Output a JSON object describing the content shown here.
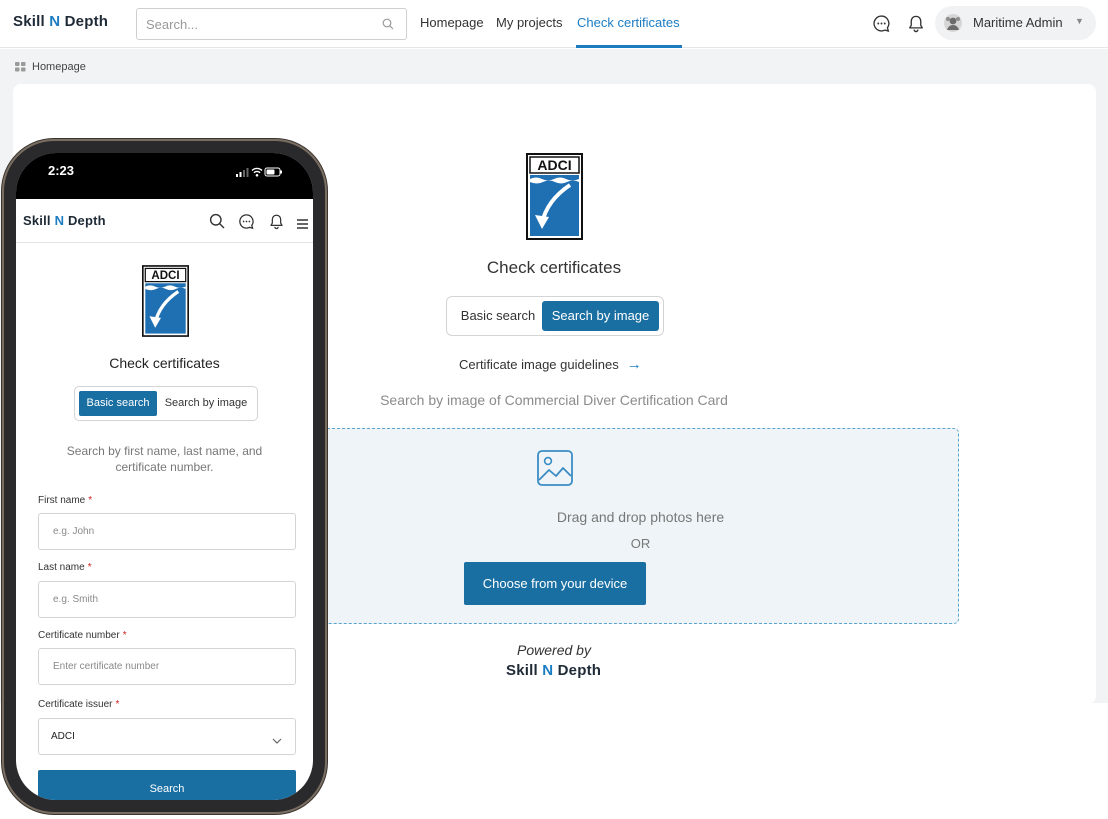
{
  "brand": {
    "part1": "Skill ",
    "n": "N",
    "part2": " Depth"
  },
  "topbar": {
    "search_placeholder": "Search...",
    "nav": [
      {
        "label": "Homepage"
      },
      {
        "label": "My projects"
      },
      {
        "label": "Check certificates",
        "active": true
      }
    ],
    "user_name": "Maritime Admin"
  },
  "breadcrumb": {
    "label": "Homepage"
  },
  "main": {
    "logo_text": "ADCI",
    "title": "Check certificates",
    "tabs": {
      "basic": "Basic search",
      "image": "Search by image",
      "active": "image"
    },
    "guidelines_link": "Certificate image guidelines",
    "subtitle": "Search by image of Commercial Diver Certification Card",
    "dropzone": {
      "text": "Drag and drop photos here",
      "or": "OR",
      "button": "Choose from your device"
    },
    "powered_by": "Powered by"
  },
  "phone": {
    "time": "2:23",
    "logo_text": "ADCI",
    "title": "Check certificates",
    "tabs": {
      "basic": "Basic search",
      "image": "Search by image",
      "active": "basic"
    },
    "subtitle": "Search by first name, last name, and certificate number.",
    "fields": {
      "first_name": {
        "label": "First name",
        "placeholder": "e.g. John"
      },
      "last_name": {
        "label": "Last name",
        "placeholder": "e.g. Smith"
      },
      "cert_number": {
        "label": "Certificate number",
        "placeholder": "Enter certificate number"
      },
      "issuer": {
        "label": "Certificate issuer",
        "value": "ADCI"
      }
    },
    "required_mark": "*",
    "search_button": "Search"
  },
  "colors": {
    "accent": "#1a6fa2",
    "link": "#1c7cc2",
    "required": "#d21f1f"
  }
}
